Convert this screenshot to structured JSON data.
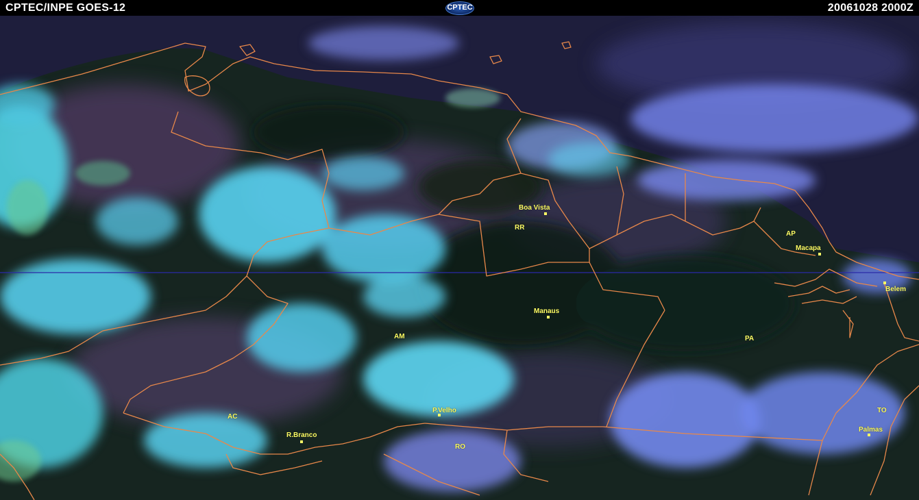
{
  "header": {
    "left_title": "CPTEC/INPE  GOES-12",
    "logo_text": "CPTEC",
    "right_timestamp": "20061028  2000Z"
  },
  "map": {
    "cities": [
      {
        "id": "boa-vista",
        "name": "Boa Vista"
      },
      {
        "id": "macapa",
        "name": "Macapa"
      },
      {
        "id": "belem",
        "name": "Belem"
      },
      {
        "id": "manaus",
        "name": "Manaus"
      },
      {
        "id": "p-velho",
        "name": "P.Velho"
      },
      {
        "id": "r-branco",
        "name": "R.Branco"
      },
      {
        "id": "palmas",
        "name": "Palmas"
      }
    ],
    "states": [
      {
        "id": "rr",
        "name": "RR"
      },
      {
        "id": "ap",
        "name": "AP"
      },
      {
        "id": "am",
        "name": "AM"
      },
      {
        "id": "pa",
        "name": "PA"
      },
      {
        "id": "ac",
        "name": "AC"
      },
      {
        "id": "ro",
        "name": "RO"
      },
      {
        "id": "to",
        "name": "TO"
      }
    ],
    "colors": {
      "borders": "#e8884a",
      "labels": "#ffff66",
      "equator": "#2a2aa8",
      "cloud_cyan": "#4fd8ec",
      "cloud_blue": "#6a7ef0",
      "land_dark": "#14221e",
      "ocean": "#1e1e3c"
    }
  }
}
